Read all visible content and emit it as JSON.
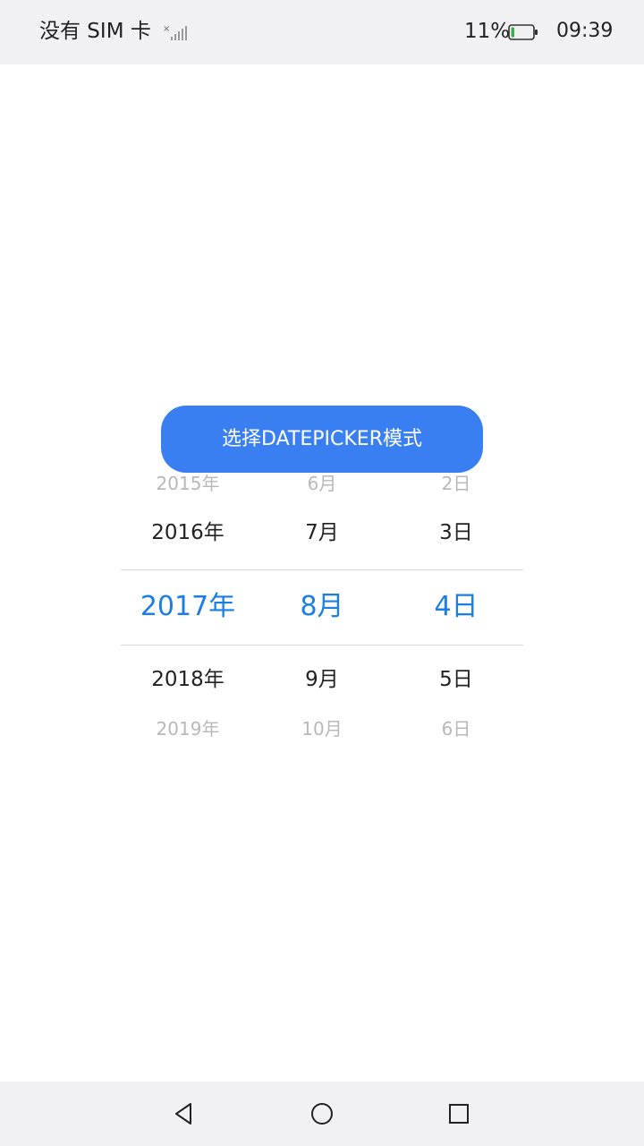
{
  "status_bar": {
    "carrier": "没有 SIM 卡",
    "battery_percent": "11%",
    "time": "09:39",
    "icons": [
      "signal-icon",
      "battery-icon"
    ]
  },
  "mode_button": {
    "label": "选择DATEPICKER模式"
  },
  "date_picker": {
    "years": [
      "2015年",
      "2016年",
      "2017年",
      "2018年",
      "2019年"
    ],
    "months": [
      "6月",
      "7月",
      "8月",
      "9月",
      "10月"
    ],
    "days": [
      "2日",
      "3日",
      "4日",
      "5日",
      "6日"
    ],
    "selected": {
      "year": "2017年",
      "month": "8月",
      "day": "4日"
    },
    "accent_color": "#1a7ee6"
  },
  "nav_bar": {
    "icons": [
      "back-icon",
      "home-icon",
      "recents-icon"
    ]
  },
  "colors": {
    "button": "#3a7ff2",
    "bars": "#f1f1f3"
  }
}
